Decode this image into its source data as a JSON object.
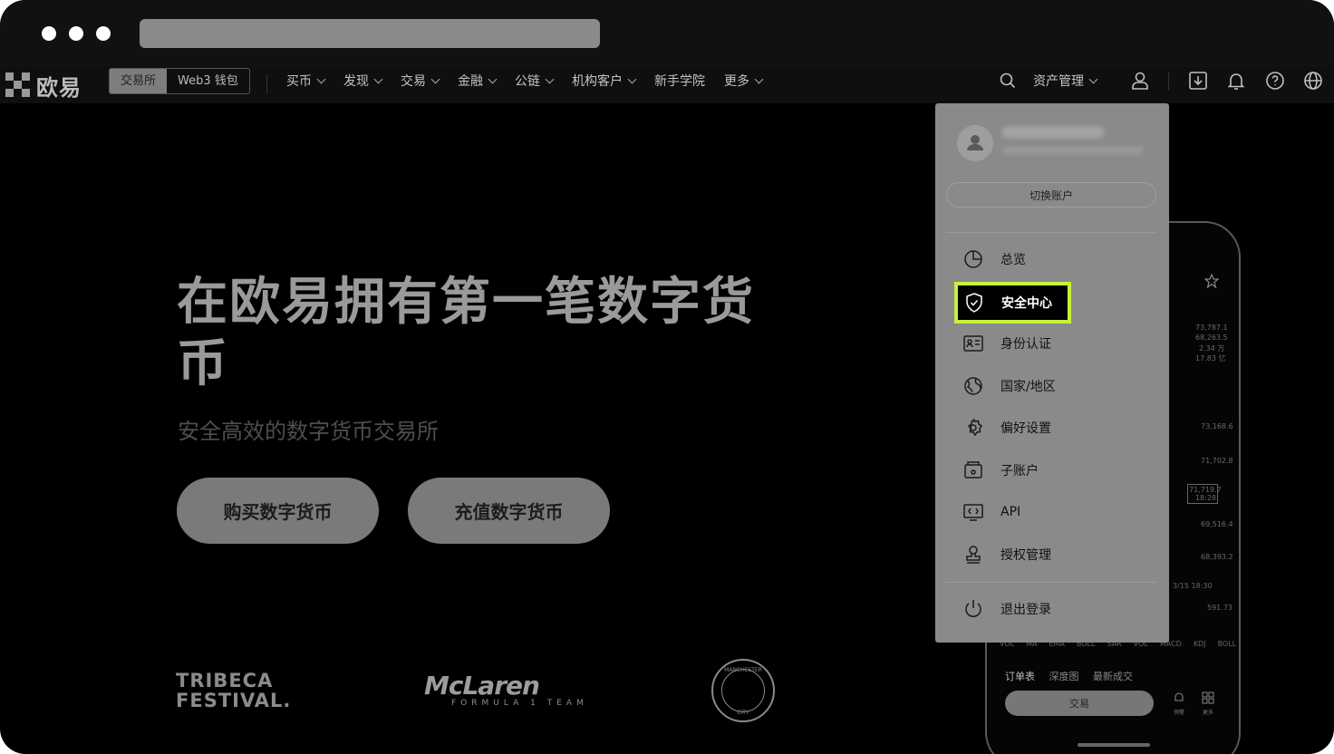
{
  "nav": {
    "logo_text": "欧易",
    "seg_exchange": "交易所",
    "seg_wallet": "Web3 钱包",
    "menu": [
      "买币",
      "发现",
      "交易",
      "金融",
      "公链",
      "机构客户",
      "新手学院",
      "更多"
    ],
    "asset_mgmt": "资产管理"
  },
  "hero": {
    "title": "在欧易拥有第一笔数字货币",
    "subtitle": "安全高效的数字货币交易所",
    "buy_button": "购买数字货币",
    "deposit_button": "充值数字货币"
  },
  "partners": {
    "tribeca_line1": "TRIBECA",
    "tribeca_line2": "FESTIVAL.",
    "mclaren_name": "McLaren",
    "mclaren_sub": "FORMULA 1 TEAM",
    "mancity_top": "MANCHESTER",
    "mancity_bottom": "CITY"
  },
  "phone": {
    "prices": [
      "73,787.1",
      "68,263.5",
      "2.34 万",
      "17.83 亿"
    ],
    "axis": [
      "73,168.6",
      "71,702.8",
      "69,516.4",
      "68,393.2",
      "591.73"
    ],
    "crosshair_value": "71,719.7",
    "crosshair_time": "18:28",
    "datetime": "3/15 18:30",
    "indicators": [
      "VOL",
      "MA",
      "EMA",
      "BOLL",
      "SAR",
      "VOL",
      "MACD",
      "KDJ",
      "BOLL"
    ],
    "tabs": [
      "订单表",
      "深度图",
      "最新成交"
    ],
    "trade_button": "交易",
    "alert_label": "预警",
    "more_label": "更多"
  },
  "dropdown": {
    "switch_account": "切换账户",
    "items": [
      "总览",
      "安全中心",
      "身份认证",
      "国家/地区",
      "偏好设置",
      "子账户",
      "API",
      "授权管理"
    ],
    "logout": "退出登录"
  }
}
